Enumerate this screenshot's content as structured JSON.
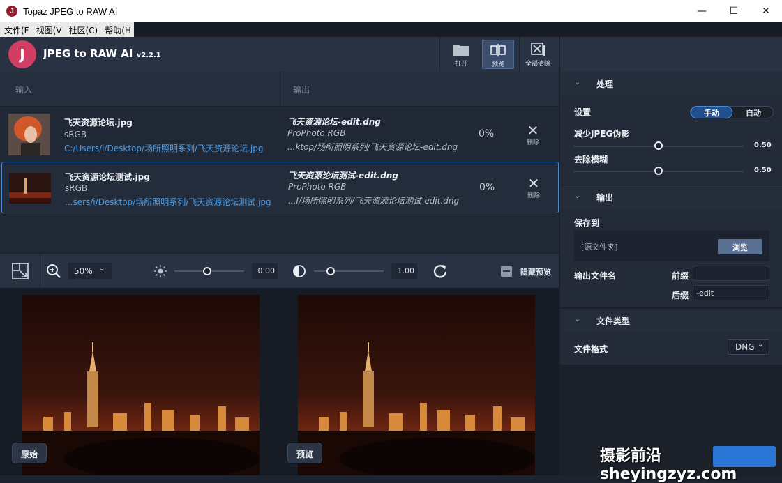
{
  "window": {
    "title": "Topaz JPEG to RAW AI",
    "icon_letter": "J"
  },
  "menubar": {
    "items": [
      "文件(F",
      "视图(V",
      "社区(C)",
      "帮助(H"
    ]
  },
  "header": {
    "app_name": "JPEG to RAW AI",
    "version": "v2.2.1",
    "logo_letter": "J"
  },
  "toolbar": {
    "open_label": "打开",
    "preview_label": "预览",
    "clear_all_label": "全部清除"
  },
  "columns": {
    "input": "输入",
    "output": "输出"
  },
  "files": [
    {
      "name": "飞天资源论坛.jpg",
      "colorspace": "sRGB",
      "path": "C:/Users/i/Desktop/场所照明系列/飞天资源论坛.jpg",
      "output_name": "飞天资源论坛-edit.dng",
      "output_colorspace": "ProPhoto RGB",
      "output_path": "...ktop/场所照明系列/飞天资源论坛-edit.dng",
      "progress": "0%",
      "delete_label": "删除"
    },
    {
      "name": "飞天资源论坛测试.jpg",
      "colorspace": "sRGB",
      "path": "...sers/i/Desktop/场所照明系列/飞天资源论坛测试.jpg",
      "output_name": "飞天资源论坛测试-edit.dng",
      "output_colorspace": "ProPhoto RGB",
      "output_path": "...I/场所照明系列/飞天资源论坛测试-edit.dng",
      "progress": "0%",
      "delete_label": "删除"
    }
  ],
  "preview_bar": {
    "zoom": "50%",
    "brightness_value": "0.00",
    "contrast_value": "1.00",
    "hide_preview_label": "隐藏预览"
  },
  "preview": {
    "original_label": "原始",
    "preview_label": "预览"
  },
  "sidebar": {
    "process": {
      "title": "处理",
      "settings_label": "设置",
      "mode_manual": "手动",
      "mode_auto": "自动",
      "reduce_jpeg_label": "减少JPEG伪影",
      "reduce_jpeg_value": "0.50",
      "reduce_jpeg_level": 0.5,
      "deblur_label": "去除模糊",
      "deblur_value": "0.50",
      "deblur_level": 0.5
    },
    "output": {
      "title": "输出",
      "save_to_label": "保存到",
      "save_to_value": "[源文件夹]",
      "browse_label": "浏览",
      "filename_label": "输出文件名",
      "prefix_label": "前缀",
      "prefix_value": "",
      "suffix_label": "后缀",
      "suffix_value": "-edit"
    },
    "filetype": {
      "title": "文件类型",
      "format_label": "文件格式",
      "format_value": "DNG"
    }
  },
  "watermark": "摄影前沿 sheyingzyz.com",
  "colors": {
    "accent": "#4c8bd3",
    "logo": "#d23d63",
    "panel": "#283243"
  }
}
